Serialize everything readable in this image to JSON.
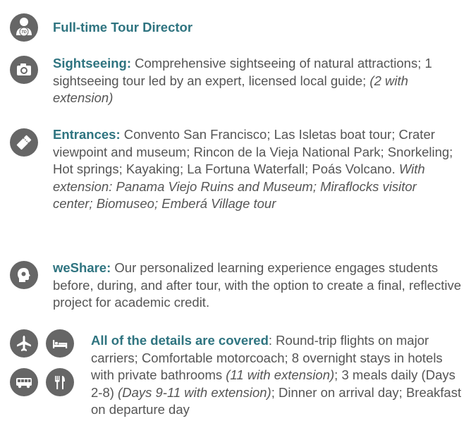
{
  "icons": {
    "tour_director": "tour-director-badge-icon",
    "sightseeing": "camera-icon",
    "entrances": "ticket-icon",
    "weshare": "head-icon",
    "flights": "airplane-icon",
    "hotel": "bed-icon",
    "motorcoach": "bus-icon",
    "meals": "fork-knife-icon"
  },
  "colors": {
    "accent": "#2f7480",
    "icon_bg": "#666666",
    "body_text": "#555555"
  },
  "tour_director": {
    "badge": "TD",
    "label": "Full-time Tour Director"
  },
  "sightseeing": {
    "lead": "Sightseeing:",
    "body": " Comprehensive sightseeing of natural attractions; 1 sightseeing tour led by an expert, licensed local guide; ",
    "italic": "(2 with extension)"
  },
  "entrances": {
    "lead": "Entrances:",
    "body": " Convento San Francisco; Las Isletas boat tour; Crater viewpoint and museum; Rincon de la Vieja National Park; Snorkeling; Hot springs; Kayaking; La Fortuna Waterfall; Poás Volcano. ",
    "italic": "With extension: Panama Viejo Ruins and Museum; Miraflocks visitor center; Biomuseo; Emberá Village tour"
  },
  "weshare": {
    "lead": "weShare:",
    "body": " Our personalized learning experience engages students before, during, and after tour, with the option to create a final, reflective project for academic credit."
  },
  "details": {
    "lead": "All of the details are covered",
    "body1": ": Round-trip flights on major carriers; Comfortable motorcoach; 8 overnight stays in hotels with private bathrooms ",
    "italic1": "(11 with extension)",
    "body2": "; 3 meals daily (Days 2-8) ",
    "italic2": "(Days 9-11 with extension)",
    "body3": "; Dinner on arrival day; Breakfast on departure day"
  }
}
